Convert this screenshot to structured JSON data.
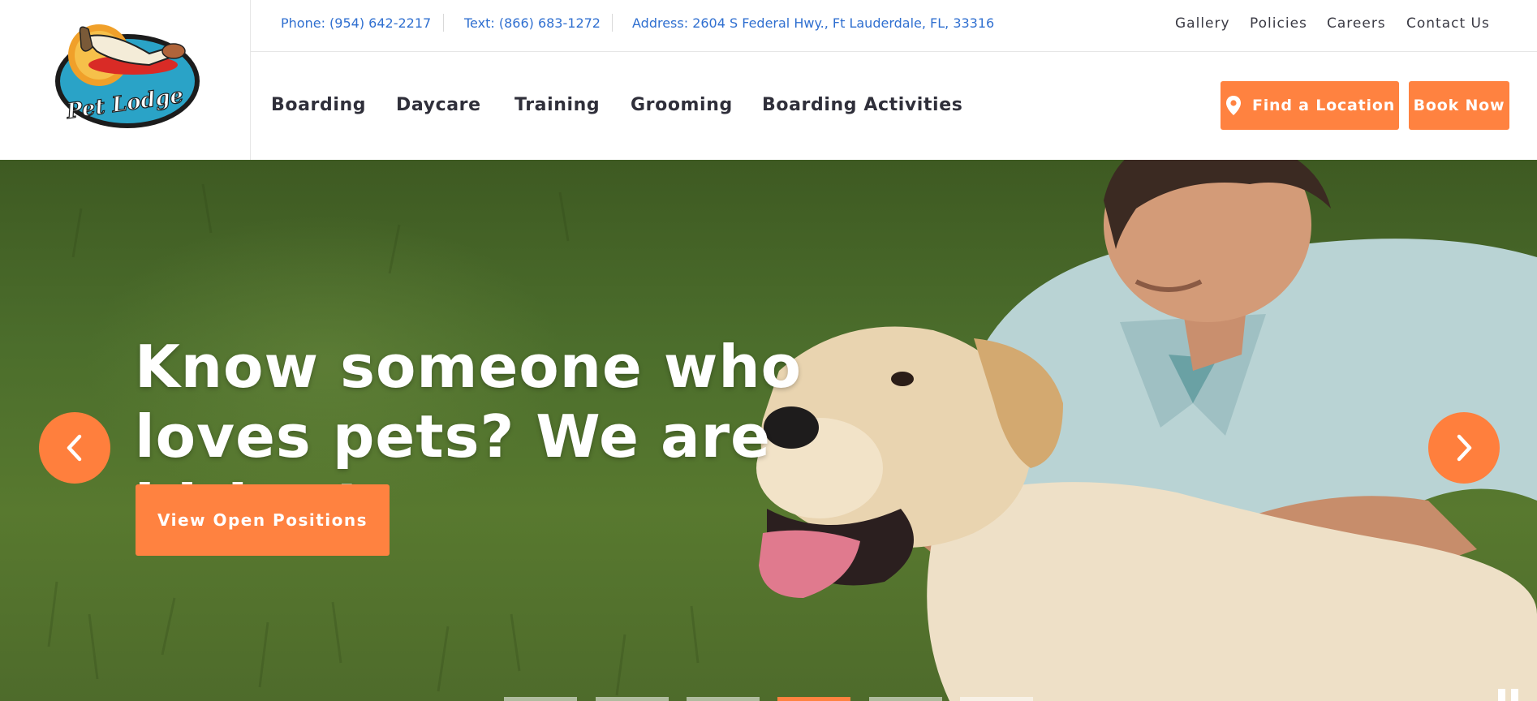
{
  "brand": {
    "logo_text": "Pet Lodge"
  },
  "topbar": {
    "phone": "Phone: (954) 642-2217",
    "text": "Text: (866) 683-1272",
    "address": "Address: 2604 S Federal Hwy., Ft Lauderdale, FL, 33316",
    "links": [
      "Gallery",
      "Policies",
      "Careers",
      "Contact Us"
    ]
  },
  "nav": {
    "items": [
      "Boarding",
      "Daycare",
      "Training",
      "Grooming",
      "Boarding Activities"
    ],
    "find_location": "Find a Location",
    "book_now": "Book Now"
  },
  "hero": {
    "title": "Know someone who loves pets? We are hiring!",
    "cta": "View Open Positions",
    "slide_count": 6,
    "active_slide": 4
  },
  "colors": {
    "accent": "#ff8240",
    "link_blue": "#2f6fd0",
    "nav_text": "#2f2f3a",
    "grass": "#4c6e2c"
  },
  "icons": {
    "location": "map-pin-icon",
    "prev": "chevron-left-icon",
    "next": "chevron-right-icon",
    "pause": "pause-icon"
  }
}
